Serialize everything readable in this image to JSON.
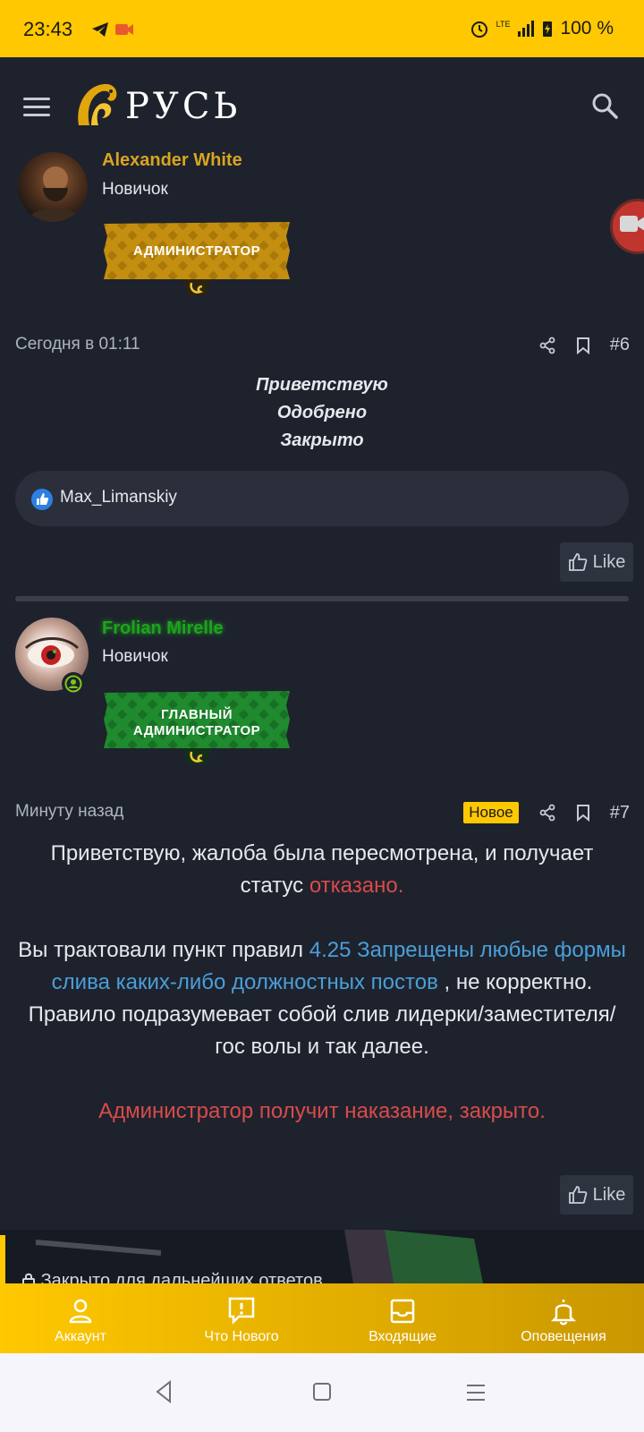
{
  "statusbar": {
    "time": "23:43",
    "battery": "100 %",
    "network": "LTE"
  },
  "header": {
    "logo_text": "РУСЬ"
  },
  "post1": {
    "username": "Alexander White",
    "role": "Новичок",
    "banner": "АДМИНИСТРАТОР",
    "timestamp": "Сегодня в 01:11",
    "number": "#6",
    "body": [
      "Приветствую",
      "Одобрено",
      "Закрыто"
    ],
    "liker": "Max_Limanskiy",
    "like_label": "Like"
  },
  "post2": {
    "username": "Frolian Mirelle",
    "role": "Новичок",
    "banner_line1": "ГЛАВНЫЙ",
    "banner_line2": "АДМИНИСТРАТОР",
    "timestamp": "Минуту назад",
    "badge": "Новое",
    "number": "#7",
    "p1_a": "Приветствую, жалоба была пересмотрена, и получает статус ",
    "p1_red": "отказано.",
    "p2_a": "Вы трактовали пункт правил ",
    "p2_link": "4.25 Запрещены любые формы слива каких-либо должностных постов",
    "p2_b": " , не корректно.",
    "p3": "Правило подразумевает собой слив лидерки/заместителя/гос волы и так далее.",
    "p4_red": "Администратор получит наказание, закрыто.",
    "like_label": "Like"
  },
  "closed_notice": "Закрыто для дальнейших ответов.",
  "bottomnav": [
    {
      "label": "Аккаунт",
      "icon": "account-icon"
    },
    {
      "label": "Что Нового",
      "icon": "whats-new-icon"
    },
    {
      "label": "Входящие",
      "icon": "inbox-icon"
    },
    {
      "label": "Оповещения",
      "icon": "bell-icon"
    }
  ],
  "colors": {
    "accent": "#ffc800",
    "bg": "#1e222d",
    "admin_name": "#d9a520",
    "chief_admin_name": "#1ea31e",
    "red_text": "#d94b4b",
    "link": "#4a9fd8"
  }
}
